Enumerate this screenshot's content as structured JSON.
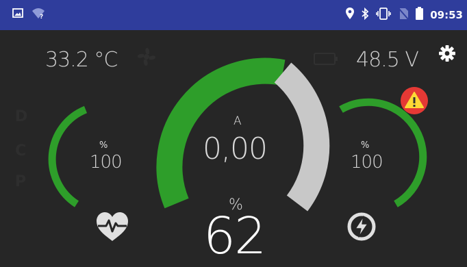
{
  "status_bar": {
    "time": "09:53",
    "left_icons": [
      "image-icon",
      "wifi-question-icon"
    ],
    "right_icons": [
      "location-icon",
      "bluetooth-icon",
      "vibrate-icon",
      "no-sim-icon",
      "battery-icon"
    ],
    "background_color": "#2f3d9c"
  },
  "dashboard": {
    "temperature": "33.2 °C",
    "voltage": "48.5 V",
    "mode_letters": [
      "D",
      "C",
      "P"
    ],
    "current": {
      "unit": "A",
      "value": "0,00"
    },
    "battery_percent": {
      "unit": "%",
      "value": "62",
      "fraction": 0.62
    },
    "left_gauge": {
      "unit": "%",
      "value": "100",
      "fraction": 1.0,
      "icon": "heart-pulse-icon"
    },
    "right_gauge": {
      "unit": "%",
      "value": "100",
      "fraction": 1.0,
      "icon": "lightning-icon"
    },
    "colors": {
      "active": "#2e9e2a",
      "inactive": "#c8c8c8",
      "warning": "#e53935"
    }
  }
}
